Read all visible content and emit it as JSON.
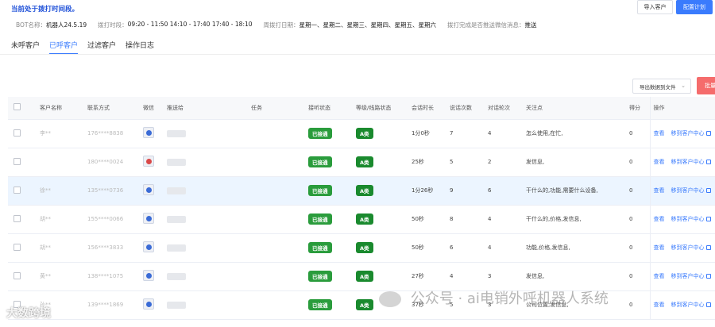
{
  "header": {
    "notice": "当前处于拨打时间段。",
    "import_label": "导入客户",
    "config_label": "配置计划"
  },
  "info": {
    "bot_label": "BOT名称：",
    "bot_value": "机器人24.5.19",
    "time_label": "拨打时段：",
    "time_value": "09:20 - 11:50 14:10 - 17:40 17:40 - 18:10",
    "days_label": "周拨打日期：",
    "days_value": "星期一、星期二、星期三、星期四、星期五、星期六",
    "wechat_label": "拨打完成是否推送微信消息：",
    "wechat_value": "推送"
  },
  "tabs": [
    "未呼客户",
    "已呼客户",
    "过滤客户",
    "操作日志"
  ],
  "toolbar": {
    "export_label": "导出数据到文件",
    "red_btn": "批量"
  },
  "table": {
    "columns": [
      "客户名称",
      "联系方式",
      "微信",
      "推送给",
      "任务",
      "接听状态",
      "等级/线路状态",
      "会话时长",
      "说话次数",
      "对话轮次",
      "关注点",
      "得分",
      "操作"
    ],
    "rows": [
      {
        "name": "李**",
        "phone": "176****8838",
        "status": "已接通",
        "level": "A类",
        "duration": "1分0秒",
        "speak": "7",
        "rounds": "4",
        "focus": "怎么使用,在忙,",
        "score": "0"
      },
      {
        "name": "",
        "phone": "180****0024",
        "status": "已接通",
        "level": "A类",
        "duration": "25秒",
        "speak": "5",
        "rounds": "2",
        "focus": "发信息,",
        "score": "0"
      },
      {
        "name": "徐**",
        "phone": "135****0736",
        "status": "已接通",
        "level": "A类",
        "duration": "1分26秒",
        "speak": "9",
        "rounds": "6",
        "focus": "干什么的,功能,需要什么设备,",
        "score": "0"
      },
      {
        "name": "胡**",
        "phone": "155****0066",
        "status": "已接通",
        "level": "A类",
        "duration": "50秒",
        "speak": "8",
        "rounds": "4",
        "focus": "干什么的,价格,发信息,",
        "score": "0"
      },
      {
        "name": "胡**",
        "phone": "156****3833",
        "status": "已接通",
        "level": "A类",
        "duration": "50秒",
        "speak": "6",
        "rounds": "4",
        "focus": "功能,价格,发信息,",
        "score": "0"
      },
      {
        "name": "黄**",
        "phone": "138****1075",
        "status": "已接通",
        "level": "A类",
        "duration": "27秒",
        "speak": "4",
        "rounds": "3",
        "focus": "发信息,",
        "score": "0"
      },
      {
        "name": "孙**",
        "phone": "139****1869",
        "status": "已接通",
        "level": "A类",
        "duration": "37秒",
        "speak": "5",
        "rounds": "3",
        "focus": "公司位置,发信息,",
        "score": "0"
      }
    ],
    "op_view": "查看",
    "op_move": "移到客户中心"
  },
  "watermark": {
    "left": "大数跨境",
    "right": "公众号 · ai电销外呼机器人系统"
  }
}
